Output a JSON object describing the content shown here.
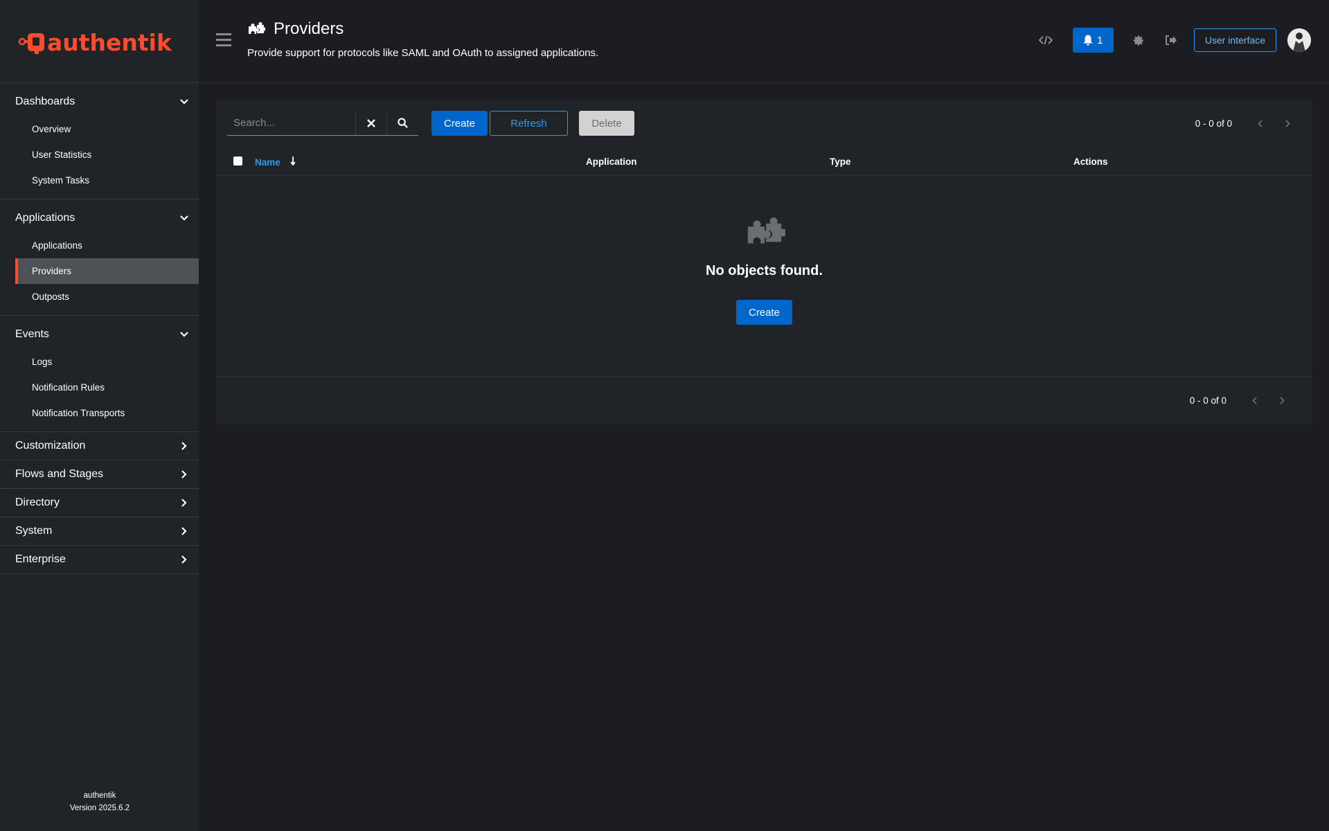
{
  "brand": {
    "name": "authentik",
    "color": "#fd4b2d"
  },
  "sidebar": {
    "groups": [
      {
        "label": "Dashboards",
        "expanded": true,
        "items": [
          "Overview",
          "User Statistics",
          "System Tasks"
        ]
      },
      {
        "label": "Applications",
        "expanded": true,
        "items": [
          "Applications",
          "Providers",
          "Outposts"
        ],
        "active": "Providers"
      },
      {
        "label": "Events",
        "expanded": true,
        "items": [
          "Logs",
          "Notification Rules",
          "Notification Transports"
        ]
      },
      {
        "label": "Customization",
        "expanded": false
      },
      {
        "label": "Flows and Stages",
        "expanded": false
      },
      {
        "label": "Directory",
        "expanded": false
      },
      {
        "label": "System",
        "expanded": false
      },
      {
        "label": "Enterprise",
        "expanded": false
      }
    ],
    "footer": {
      "product": "authentik",
      "version": "Version 2025.6.2"
    }
  },
  "header": {
    "title": "Providers",
    "title_icon": "puzzle-piece-icon",
    "description": "Provide support for protocols like SAML and OAuth to assigned applications.",
    "notification_count": "1",
    "user_interface_label": "User interface",
    "icons": [
      "code-icon",
      "bell-icon",
      "gear-icon",
      "sign-out-icon",
      "avatar"
    ]
  },
  "toolbar": {
    "search_placeholder": "Search...",
    "create_label": "Create",
    "refresh_label": "Refresh",
    "delete_label": "Delete",
    "pagination_top": "0 - 0 of 0",
    "pagination_bottom": "0 - 0 of 0"
  },
  "table": {
    "columns": [
      "Name",
      "Application",
      "Type",
      "Actions"
    ],
    "sorted_column": "Name"
  },
  "empty_state": {
    "title": "No objects found.",
    "create_label": "Create"
  },
  "colors": {
    "accent": "#fd4b2d",
    "primary": "#0066cc",
    "link": "#2b9af3",
    "background": "#1b1d21",
    "surface": "#212427"
  }
}
